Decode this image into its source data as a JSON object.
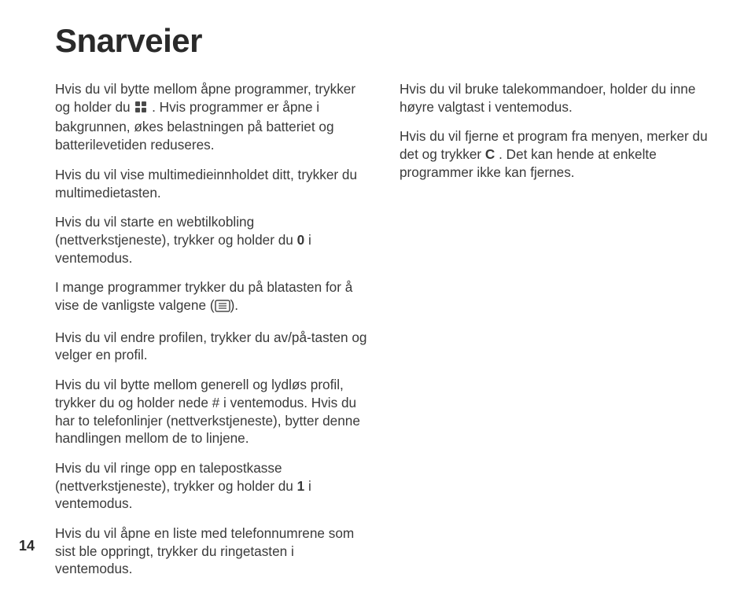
{
  "heading": "Snarveier",
  "page_number": "14",
  "left": {
    "p1a": "Hvis du vil bytte mellom åpne programmer, trykker og holder du ",
    "p1b": ". Hvis programmer er åpne i bakgrunnen, økes belastningen på batteriet og batterilevetiden reduseres.",
    "p2": "Hvis du vil vise multimedieinnholdet ditt, trykker du multimedietasten.",
    "p3a": "Hvis du vil starte en webtilkobling (nettverkstjeneste), trykker og holder du ",
    "p3_key": "0",
    "p3b": " i ventemodus.",
    "p4a": "I mange programmer trykker du på blatasten for å vise de vanligste valgene (",
    "p4b": ").",
    "p5": "Hvis du vil endre profilen, trykker du av/på-tasten og velger en profil.",
    "p6": "Hvis du vil bytte mellom generell og lydløs profil, trykker du og holder nede # i ventemodus. Hvis du har to telefonlinjer (nettverkstjeneste), bytter denne handlingen mellom de to linjene.",
    "p7a": "Hvis du vil ringe opp en talepostkasse (nettverkstjeneste), trykker og holder du ",
    "p7_key": "1",
    "p7b": " i ventemodus.",
    "p8": "Hvis du vil åpne en liste med telefonnumrene som sist ble oppringt, trykker du ringetasten i ventemodus."
  },
  "right": {
    "p1": "Hvis du vil bruke talekommandoer, holder du inne høyre valgtast i ventemodus.",
    "p2a": "Hvis du vil fjerne et program fra menyen, merker du det og trykker ",
    "p2_key": "C",
    "p2b": " . Det kan hende at enkelte programmer ikke kan fjernes."
  }
}
